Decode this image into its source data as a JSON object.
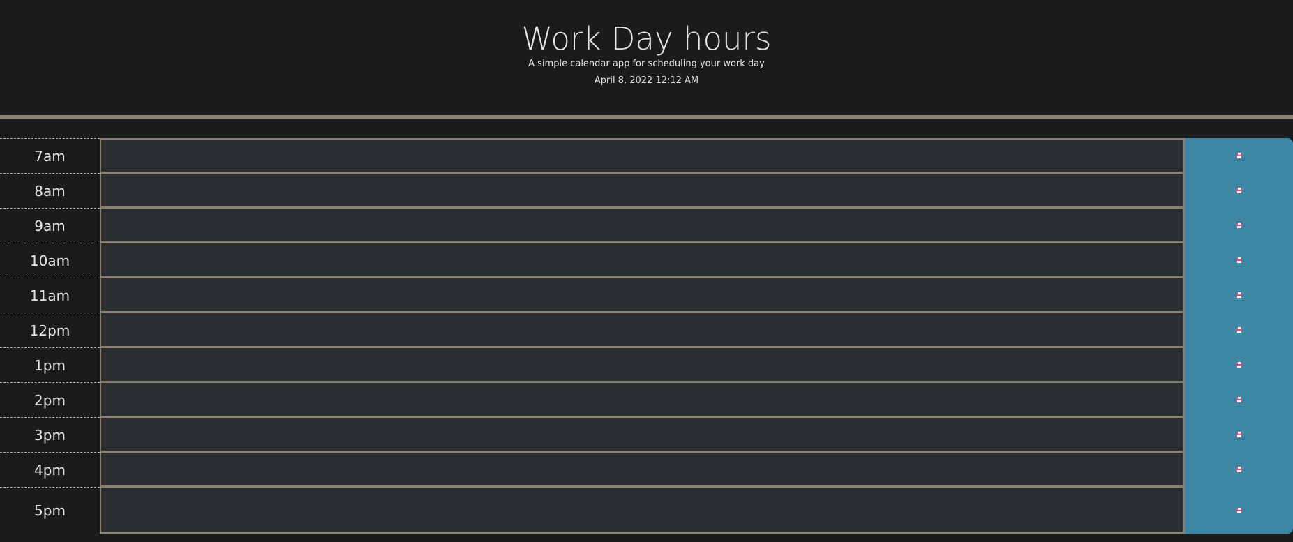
{
  "header": {
    "title": "Work Day hours",
    "subtitle": "A simple calendar app for scheduling your work day",
    "date": "April 8, 2022 12:12 AM"
  },
  "rows": [
    {
      "hour": "7am",
      "text": ""
    },
    {
      "hour": "8am",
      "text": ""
    },
    {
      "hour": "9am",
      "text": ""
    },
    {
      "hour": "10am",
      "text": ""
    },
    {
      "hour": "11am",
      "text": ""
    },
    {
      "hour": "12pm",
      "text": ""
    },
    {
      "hour": "1pm",
      "text": ""
    },
    {
      "hour": "2pm",
      "text": ""
    },
    {
      "hour": "3pm",
      "text": ""
    },
    {
      "hour": "4pm",
      "text": ""
    },
    {
      "hour": "5pm",
      "text": ""
    }
  ],
  "save_icon": "floppy-disk-icon",
  "colors": {
    "background": "#1a1b1d",
    "row_background": "#2b2e31",
    "border": "#8b8271",
    "save_button": "#3d86a4"
  }
}
